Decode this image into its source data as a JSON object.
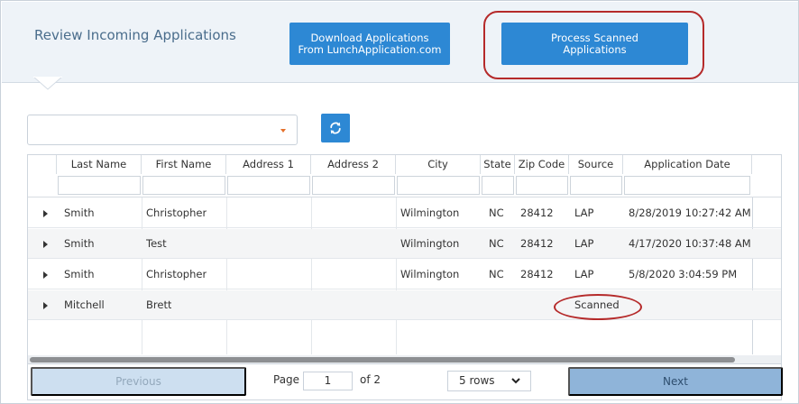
{
  "header": {
    "title": "Review Incoming Applications",
    "download_button": [
      "Download Applications",
      "From LunchApplication.com"
    ],
    "process_button": [
      "Process Scanned",
      "Applications"
    ]
  },
  "filter": {
    "dropdown_value": "",
    "refresh_icon": "refresh-icon"
  },
  "grid": {
    "columns": [
      "Last Name",
      "First Name",
      "Address 1",
      "Address 2",
      "City",
      "State",
      "Zip Code",
      "Source",
      "Application Date"
    ],
    "rows": [
      {
        "last": "Smith",
        "first": "Christopher",
        "addr1": "",
        "addr2": "",
        "city": "Wilmington",
        "state": "NC",
        "zip": "28412",
        "source": "LAP",
        "date": "8/28/2019 10:27:42 AM"
      },
      {
        "last": "Smith",
        "first": "Test",
        "addr1": "",
        "addr2": "",
        "city": "Wilmington",
        "state": "NC",
        "zip": "28412",
        "source": "LAP",
        "date": "4/17/2020 10:37:48 AM"
      },
      {
        "last": "Smith",
        "first": "Christopher",
        "addr1": "",
        "addr2": "",
        "city": "Wilmington",
        "state": "NC",
        "zip": "28412",
        "source": "LAP",
        "date": "5/8/2020 3:04:59 PM"
      },
      {
        "last": "Mitchell",
        "first": "Brett",
        "addr1": "",
        "addr2": "",
        "city": "",
        "state": "",
        "zip": "",
        "source": "Scanned",
        "date": ""
      }
    ]
  },
  "pager": {
    "previous": "Previous",
    "page_label": "Page",
    "page_value": "1",
    "of_label": "of 2",
    "rows_value": "5 rows",
    "next": "Next"
  },
  "colors": {
    "accent": "#2d88d4",
    "highlight": "#b52a2a",
    "caret": "#e5702a"
  }
}
